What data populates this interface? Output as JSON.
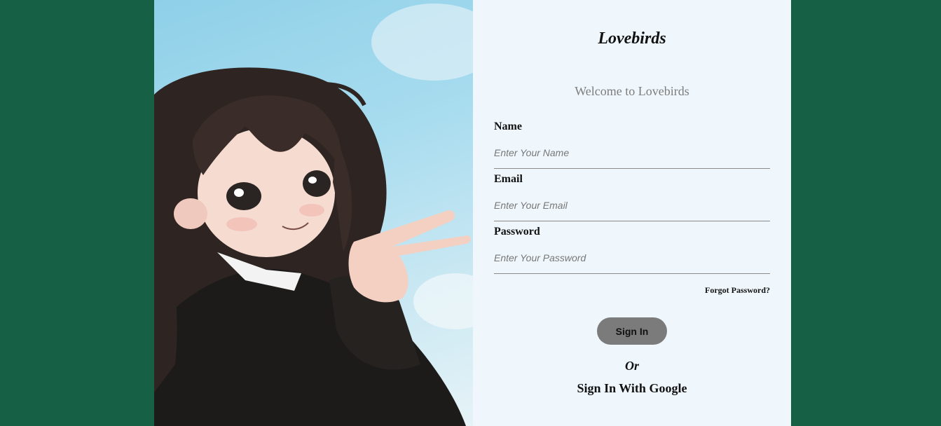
{
  "brand": "Lovebirds",
  "welcome": "Welcome to Lovebirds",
  "form": {
    "name": {
      "label": "Name",
      "placeholder": "Enter Your Name",
      "value": ""
    },
    "email": {
      "label": "Email",
      "placeholder": "Enter Your Email",
      "value": ""
    },
    "password": {
      "label": "Password",
      "placeholder": "Enter Your Password",
      "value": ""
    }
  },
  "forgot_password": "Forgot Password?",
  "sign_in_label": "Sign In",
  "or_label": "Or",
  "google_label": "Sign In With Google",
  "hero": {
    "image": "anime-girl-illustration"
  },
  "colors": {
    "page_background": "#166046",
    "panel_background": "#eff7fd",
    "button_background": "#7b7b7b"
  }
}
